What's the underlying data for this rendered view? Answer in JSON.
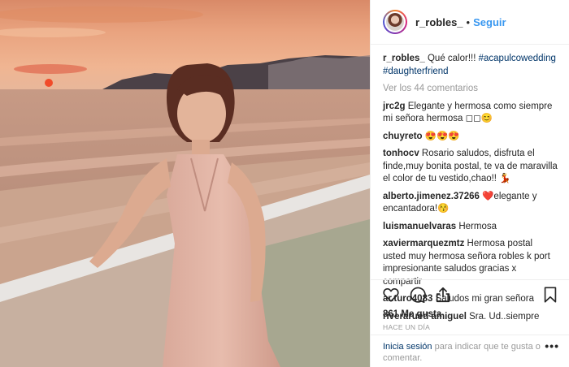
{
  "post": {
    "username": "r_robles_",
    "follow_label": "Seguir",
    "separator": "•"
  },
  "caption": {
    "username": "r_robles_",
    "text": " Qué calor!!! ",
    "hashtag1": "#acapulcowedding",
    "hashtag2": "#daughterfriend"
  },
  "view_comments": "Ver los 44 comentarios",
  "comments": [
    {
      "user": "jrc2g",
      "text": " Elegante y hermosa como siempre mi señora hermosa ◻◻😊"
    },
    {
      "user": "chuyreto",
      "text": " 😍😍😍"
    },
    {
      "user": "tonhocv",
      "text": " Rosario saludos, disfruta el finde,muy bonita postal, te va de maravilla el color de tu vestido,chao!! 💃"
    },
    {
      "user": "alberto.jimenez.37266",
      "text": " ❤️elegante y encantadora!😚"
    },
    {
      "user": "luismanuelvaras",
      "text": " Hermosa"
    },
    {
      "user": "xaviermarquezmtz",
      "text": " Hermosa postal usted muy hermosa señora robles k port impresionante saludos gracias x compartir"
    },
    {
      "user": "ar.turo4083",
      "text": " Saludos mi gran señora"
    },
    {
      "user": "riverarued amiguel",
      "text": " Sra. Ud..siempre"
    }
  ],
  "likes": "861 Me gusta",
  "timestamp": "HACE UN DÍA",
  "login": {
    "link": "Inicia sesión",
    "text": " para indicar que te gusta o comentar."
  },
  "more_options": "•••",
  "icons": {
    "like": "heart-icon",
    "comment": "comment-icon",
    "share": "share-icon",
    "save": "bookmark-icon"
  },
  "colors": {
    "accent": "#3897f0",
    "link": "#003569",
    "muted": "#999999",
    "text": "#262626"
  }
}
